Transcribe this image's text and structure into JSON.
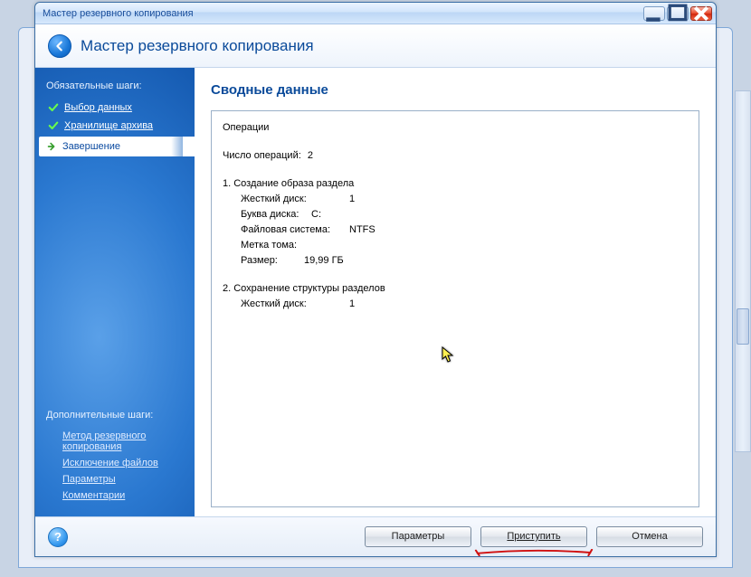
{
  "window": {
    "title": "Мастер резервного копирования",
    "header_title": "Мастер резервного копирования"
  },
  "sidebar": {
    "mandatory_title": "Обязательные шаги:",
    "optional_title": "Дополнительные шаги:",
    "steps": [
      {
        "label": "Выбор данных"
      },
      {
        "label": "Хранилище архива"
      },
      {
        "label": "Завершение"
      }
    ],
    "optional": [
      {
        "label": "Метод резервного копирования"
      },
      {
        "label": "Исключение файлов"
      },
      {
        "label": "Параметры"
      },
      {
        "label": "Комментарии"
      }
    ]
  },
  "main": {
    "title": "Сводные данные",
    "summary": {
      "operations_label": "Операции",
      "count_label": "Число операций:",
      "count_value": "2",
      "op1": {
        "title": "1. Создание образа раздела",
        "hdd_label": "Жесткий диск:",
        "hdd_value": "1",
        "drive_label": "Буква диска:",
        "drive_value": "C:",
        "fs_label": "Файловая система:",
        "fs_value": "NTFS",
        "vol_label": "Метка тома:",
        "vol_value": "",
        "size_label": "Размер:",
        "size_value": "19,99 ГБ"
      },
      "op2": {
        "title": "2. Сохранение структуры разделов",
        "hdd_label": "Жесткий диск:",
        "hdd_value": "1"
      }
    }
  },
  "footer": {
    "options": "Параметры",
    "proceed": "Приступить",
    "cancel": "Отмена"
  }
}
